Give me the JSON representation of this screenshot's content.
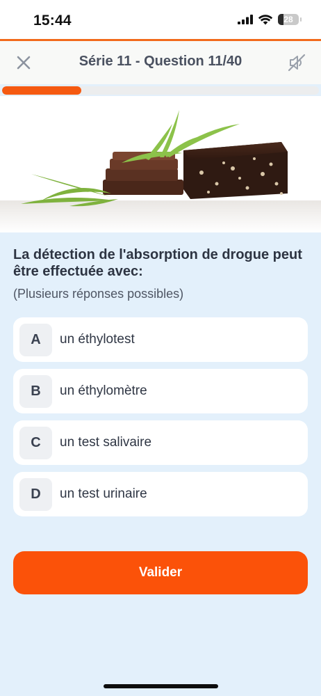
{
  "status_bar": {
    "time": "15:44",
    "battery_level": "28",
    "signal_icon": "cellular-signal-icon",
    "wifi_icon": "wifi-icon",
    "battery_icon": "battery-icon"
  },
  "header": {
    "title": "Série 11 - Question 11/40",
    "close_icon": "close-icon",
    "sound_icon": "sound-off-icon"
  },
  "progress": {
    "current": 11,
    "total": 40,
    "fraction": 0.25
  },
  "illustration": {
    "icon": "drug-illustration-image"
  },
  "question": {
    "text": "La détection de l'absorption de drogue peut être effectuée avec:",
    "hint": "(Plusieurs réponses possibles)"
  },
  "answers": [
    {
      "letter": "A",
      "text": "un éthylotest"
    },
    {
      "letter": "B",
      "text": "un éthylomètre"
    },
    {
      "letter": "C",
      "text": "un test salivaire"
    },
    {
      "letter": "D",
      "text": "un test urinaire"
    }
  ],
  "validate_button": {
    "label": "Valider"
  },
  "colors": {
    "accent": "#fb5209",
    "background": "#e3f0fb",
    "card": "#ffffff",
    "title_text": "#4a5160"
  }
}
